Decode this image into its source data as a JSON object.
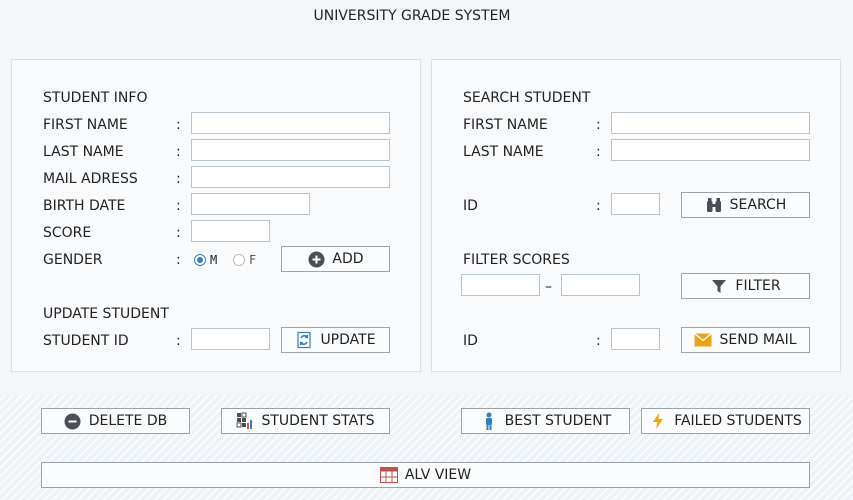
{
  "app": {
    "title": "UNIVERSITY GRADE SYSTEM"
  },
  "student_info": {
    "heading": "STUDENT INFO",
    "first_name_label": "FIRST NAME",
    "last_name_label": "LAST NAME",
    "mail_label": "MAIL ADRESS",
    "birth_label": "BIRTH DATE",
    "score_label": "SCORE",
    "gender_label": "GENDER",
    "gender_m": "M",
    "gender_f": "F",
    "gender_selected": "M",
    "colon": ":",
    "add_button": "ADD",
    "first_name_value": "",
    "last_name_value": "",
    "mail_value": "",
    "birth_value": "",
    "score_value": ""
  },
  "update_student": {
    "heading": "UPDATE STUDENT",
    "id_label": "STUDENT ID",
    "id_value": "",
    "update_button": "UPDATE"
  },
  "search_student": {
    "heading": "SEARCH STUDENT",
    "first_name_label": "FIRST NAME",
    "last_name_label": "LAST NAME",
    "id_label": "ID",
    "search_button": "SEARCH",
    "first_name_value": "",
    "last_name_value": "",
    "id_value": ""
  },
  "filter_scores": {
    "heading": "FILTER SCORES",
    "range_separator": "–",
    "from_value": "",
    "to_value": "",
    "filter_button": "FILTER"
  },
  "mail": {
    "id_label": "ID",
    "id_value": "",
    "send_button": "SEND MAIL"
  },
  "actions": {
    "delete_db": "DELETE DB",
    "student_stats": "STUDENT STATS",
    "best_student": "BEST STUDENT",
    "failed_students": "FAILED STUDENTS",
    "alv_view": "ALV VIEW"
  },
  "colors": {
    "accent_blue": "#2f7fc1",
    "mail_yellow": "#e8a317",
    "failed_orange": "#f0a30a",
    "panel_border": "#d9e1e8"
  },
  "icons": {
    "add": "plus-circle-icon",
    "update": "refresh-document-icon",
    "search": "binoculars-icon",
    "filter": "funnel-icon",
    "send_mail": "envelope-icon",
    "delete_db": "minus-circle-icon",
    "student_stats": "chart-grid-icon",
    "best_student": "person-icon",
    "failed_students": "lightning-icon",
    "alv_view": "table-icon"
  }
}
